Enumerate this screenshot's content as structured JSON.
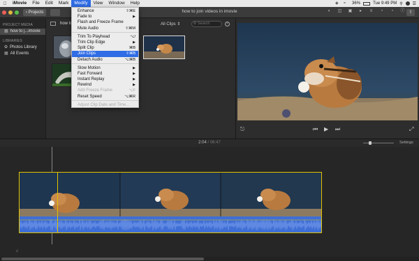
{
  "menubar": {
    "app_name": "iMovie",
    "items": [
      "File",
      "Edit",
      "Mark",
      "Modify",
      "View",
      "Window",
      "Help"
    ],
    "active_item": "Modify",
    "clock": "Tue 9:49 PM",
    "battery": "36%"
  },
  "toolbar": {
    "projects_label": "Projects",
    "window_title": "how to join videos in imovie"
  },
  "sidebar": {
    "project_media_header": "PROJECT MEDIA",
    "project_item": "how to j...imovie",
    "libraries_header": "LIBRARIES",
    "library_items": [
      "Photos Library",
      "All Events"
    ]
  },
  "browser": {
    "title": "how to j",
    "filter_label": "All Clips",
    "search_placeholder": "Search"
  },
  "timeline": {
    "timecode_current": "2:04",
    "timecode_total": "06:47",
    "settings_label": "Settings"
  },
  "modify_menu": {
    "groups": [
      [
        {
          "label": "Enhance",
          "shortcut": "⇧⌘E"
        },
        {
          "label": "Fade to",
          "submenu": true
        },
        {
          "label": "Flash and Freeze Frame"
        },
        {
          "label": "Mute Audio",
          "shortcut": "⇧⌘M"
        }
      ],
      [
        {
          "label": "Trim To Playhead",
          "shortcut": "⌥/"
        },
        {
          "label": "Trim Clip Edge",
          "submenu": true
        },
        {
          "label": "Split Clip",
          "shortcut": "⌘B"
        },
        {
          "label": "Join Clips",
          "shortcut": "⇧⌘B",
          "highlight": true
        },
        {
          "label": "Detach Audio",
          "shortcut": "⌥⌘B"
        }
      ],
      [
        {
          "label": "Slow Motion",
          "submenu": true
        },
        {
          "label": "Fast Forward",
          "submenu": true
        },
        {
          "label": "Instant Replay",
          "submenu": true
        },
        {
          "label": "Rewind",
          "submenu": true
        },
        {
          "label": "Add Freeze Frame",
          "shortcut": "⌥F",
          "disabled": true
        },
        {
          "label": "Reset Speed",
          "shortcut": "⌥⌘R"
        }
      ],
      [
        {
          "label": "Adjust Clip Date and Time...",
          "disabled": true
        }
      ]
    ]
  },
  "colors": {
    "accent": "#2f6ce5",
    "clip_border": "#e2c200",
    "audio_wave": "#3f6fd6"
  }
}
